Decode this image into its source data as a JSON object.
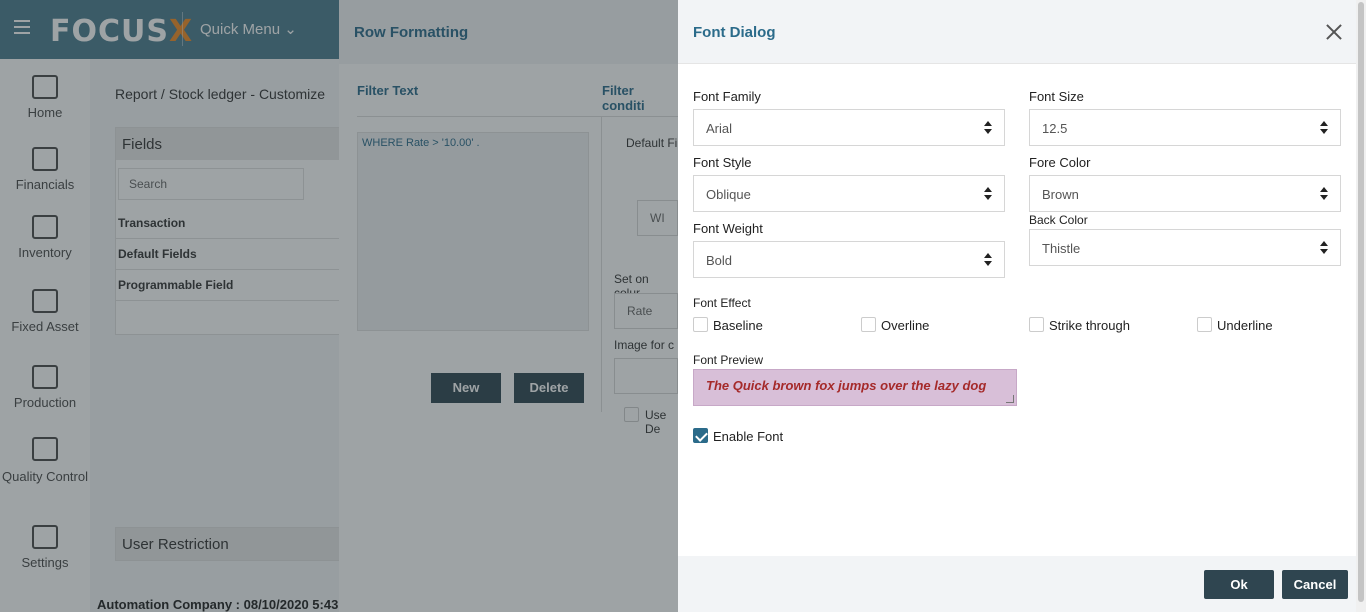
{
  "app": {
    "logo_text": "FOCUS",
    "logo_x": "X",
    "quick_menu": "Quick Menu"
  },
  "sidebar": {
    "items": [
      {
        "label": "Home",
        "icon": "home-icon"
      },
      {
        "label": "Financials",
        "icon": "financials-icon"
      },
      {
        "label": "Inventory",
        "icon": "inventory-icon"
      },
      {
        "label": "Fixed Asset",
        "icon": "fixed-asset-icon"
      },
      {
        "label": "Production",
        "icon": "production-icon"
      },
      {
        "label": "Quality Control",
        "icon": "quality-control-icon"
      },
      {
        "label": "Settings",
        "icon": "gear-icon"
      }
    ]
  },
  "main": {
    "breadcrumb": "Report  /  Stock ledger - Customize",
    "fields_title": "Fields",
    "search_placeholder": "Search",
    "tree": [
      "Transaction",
      "Default Fields",
      "Programmable Field"
    ],
    "user_restriction": "User Restriction",
    "status": "Automation Company : 08/10/2020 5:43"
  },
  "row_formatting": {
    "title": "Row Formatting",
    "filter_text_label": "Filter Text",
    "filter_condition_label": "Filter conditi",
    "filter_text_value": "WHERE Rate > '10.00' .",
    "default_fi": "Default Fi",
    "wi": "WI",
    "set_on_column": "Set on colur",
    "rate": "Rate",
    "image_for": "Image for c",
    "use_de": "Use De",
    "new_button": "New",
    "delete_button": "Delete"
  },
  "font_dialog": {
    "title": "Font Dialog",
    "font_family_label": "Font Family",
    "font_family_value": "Arial",
    "font_size_label": "Font Size",
    "font_size_value": "12.5",
    "font_style_label": "Font Style",
    "font_style_value": "Oblique",
    "fore_color_label": "Fore Color",
    "fore_color_value": "Brown",
    "font_weight_label": "Font Weight",
    "font_weight_value": "Bold",
    "back_color_label": "Back Color",
    "back_color_value": "Thistle",
    "font_effect_label": "Font Effect",
    "effects": [
      {
        "label": "Baseline",
        "checked": false
      },
      {
        "label": "Overline",
        "checked": false
      },
      {
        "label": "Strike through",
        "checked": false
      },
      {
        "label": "Underline",
        "checked": false
      }
    ],
    "font_preview_label": "Font Preview",
    "preview_text": "The Quick brown fox jumps over the lazy dog",
    "enable_font_label": "Enable Font",
    "enable_font_checked": true,
    "ok_button": "Ok",
    "cancel_button": "Cancel"
  },
  "colors": {
    "accent": "#2b6b8a",
    "button_dark": "#2f4550",
    "preview_bg": "#d8bfd8",
    "preview_fg": "#a52a2a"
  }
}
